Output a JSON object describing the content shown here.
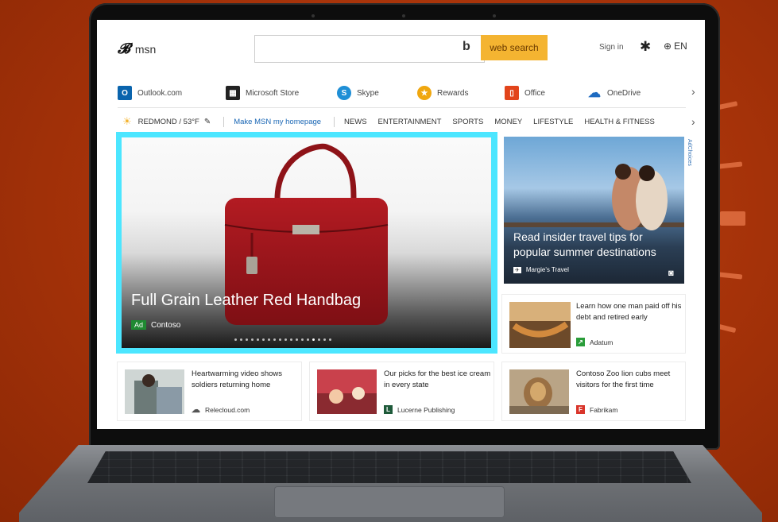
{
  "header": {
    "logo_text": "msn",
    "search_placeholder": "",
    "search_button": "web search",
    "signin": "Sign in",
    "language": "EN"
  },
  "apps": [
    {
      "label": "Outlook.com",
      "icon": "outlook-icon",
      "color": "#0a64ad"
    },
    {
      "label": "Microsoft Store",
      "icon": "store-icon",
      "color": "#222222"
    },
    {
      "label": "Skype",
      "icon": "skype-icon",
      "color": "#1f8fd6"
    },
    {
      "label": "Rewards",
      "icon": "rewards-icon",
      "color": "#f0a70f"
    },
    {
      "label": "Office",
      "icon": "office-icon",
      "color": "#e2441b"
    },
    {
      "label": "OneDrive",
      "icon": "onedrive-icon",
      "color": "#1e6bc1"
    }
  ],
  "nav": {
    "weather": "REDMOND / 53°F",
    "homepage_link": "Make MSN my homepage",
    "items": [
      "NEWS",
      "ENTERTAINMENT",
      "SPORTS",
      "MONEY",
      "LIFESTYLE",
      "HEALTH & FITNESS"
    ]
  },
  "hero": {
    "title": "Full Grain Leather Red Handbag",
    "ad_label": "Ad",
    "advertiser": "Contoso",
    "slide_count": 18,
    "active_slide": 14
  },
  "travel": {
    "title": "Read insider travel tips for popular summer destinations",
    "source": "Margie's Travel",
    "adchoices": "AdChoices"
  },
  "cards": [
    {
      "title": "Learn how one man paid off his debt and retired early",
      "source": "Adatum",
      "icon_color": "#2a9d3a"
    },
    {
      "title": "Heartwarming video shows soldiers returning home",
      "source": "Relecloud.com",
      "icon_color": "#555555"
    },
    {
      "title": "Our picks for the best ice cream in every state",
      "source": "Lucerne Publishing",
      "icon_color": "#1e5a3a"
    },
    {
      "title": "Contoso Zoo lion cubs meet visitors for the first time",
      "source": "Fabrikam",
      "icon_color": "#d9352b"
    }
  ],
  "colors": {
    "hero_focus": "#4ce6ff",
    "search_button": "#f4b431",
    "background": "#a83208"
  }
}
